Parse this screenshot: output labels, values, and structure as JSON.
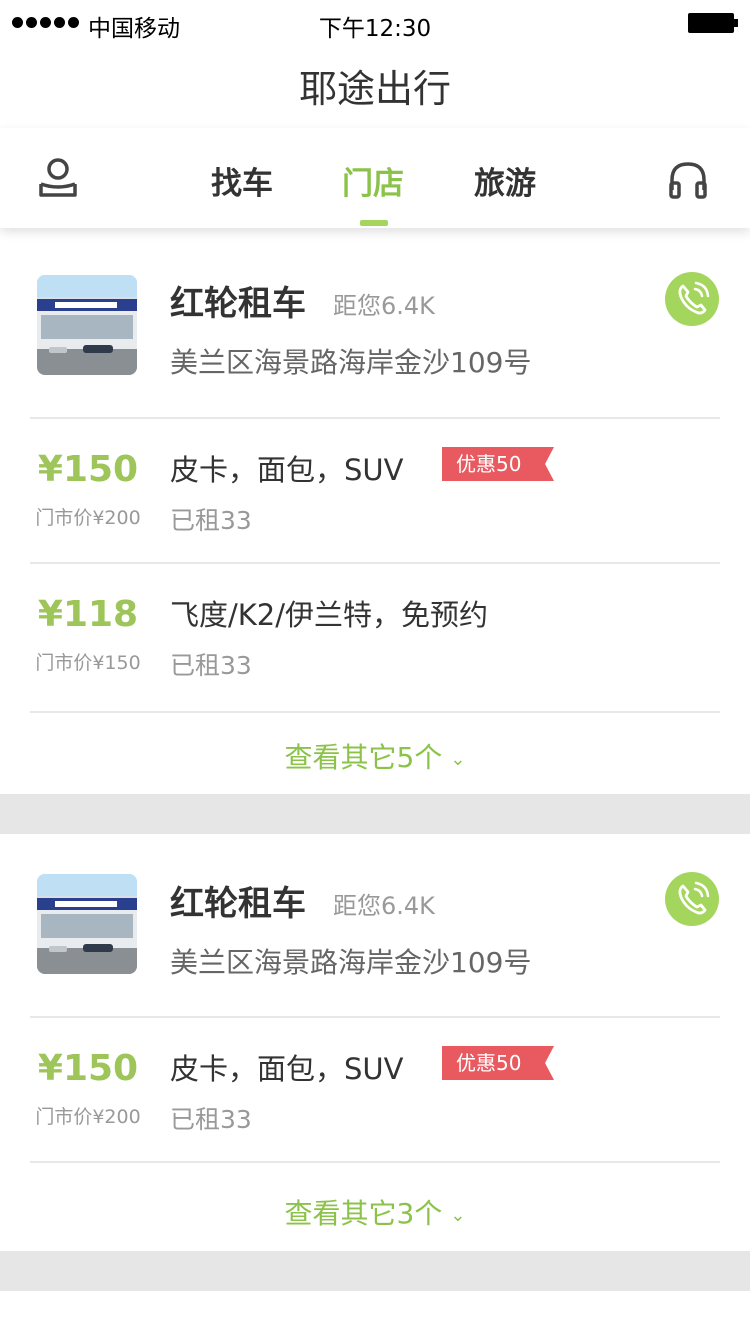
{
  "status": {
    "carrier": "中国移动",
    "time": "下午12:30"
  },
  "app_title": "耶途出行",
  "tabs": [
    {
      "label": "找车",
      "active": false
    },
    {
      "label": "门店",
      "active": true
    },
    {
      "label": "旅游",
      "active": false
    }
  ],
  "icons": {
    "user": "user-icon",
    "support": "headset-icon",
    "phone": "phone-icon",
    "more": "chevron-down-icon"
  },
  "colors": {
    "accent": "#8bc34a",
    "price": "#9ec55a",
    "phone_bg": "#a4d65e",
    "promo": "#e85a5f"
  },
  "stores": [
    {
      "name": "红轮租车",
      "distance": "距您6.4K",
      "address": "美兰区海景路海岸金沙109号",
      "offers": [
        {
          "price": "¥150",
          "store_price": "门市价¥200",
          "types": "皮卡，面包，SUV",
          "rented": "已租33",
          "promo": "优惠50"
        },
        {
          "price": "¥118",
          "store_price": "门市价¥150",
          "types": "飞度/K2/伊兰特，免预约",
          "rented": "已租33",
          "promo": ""
        }
      ],
      "more": "查看其它5个"
    },
    {
      "name": "红轮租车",
      "distance": "距您6.4K",
      "address": "美兰区海景路海岸金沙109号",
      "offers": [
        {
          "price": "¥150",
          "store_price": "门市价¥200",
          "types": "皮卡，面包，SUV",
          "rented": "已租33",
          "promo": "优惠50"
        }
      ],
      "more": "查看其它3个"
    }
  ]
}
